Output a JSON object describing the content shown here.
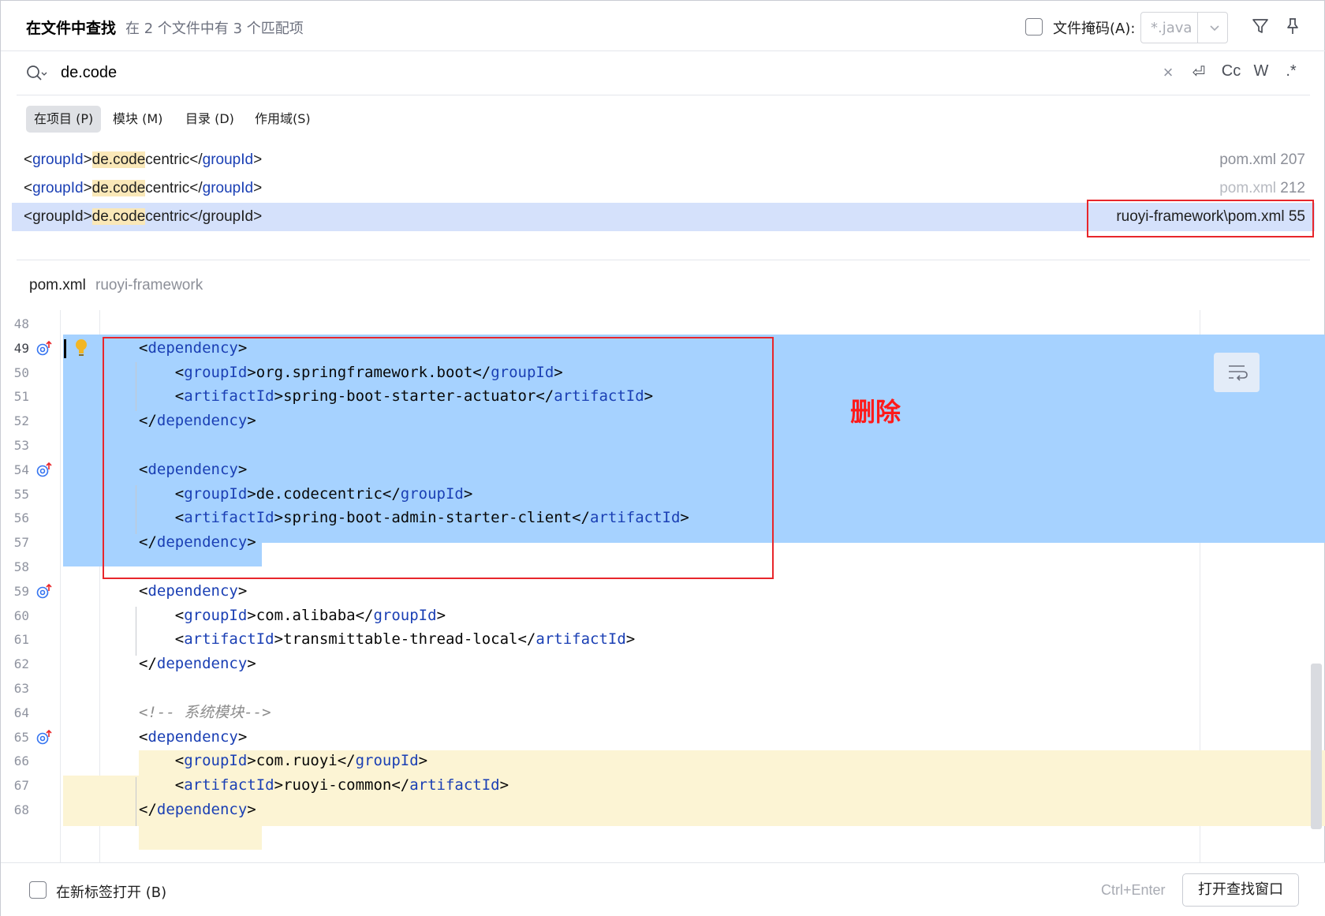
{
  "header": {
    "title": "在文件中查找",
    "subtitle": "在 2 个文件中有 3 个匹配项",
    "file_mask_label": "文件掩码(A):",
    "file_mask_value": "*.java",
    "file_mask_checked": false,
    "icons": [
      "filter-icon",
      "pin-icon"
    ]
  },
  "search": {
    "query": "de.code",
    "icons": [
      "clear-icon",
      "newline-icon",
      "match-case-icon",
      "words-icon",
      "regex-icon"
    ],
    "clear_glyph": "×",
    "newline_glyph": "⏎",
    "match_case_label": "Cc",
    "words_label": "W",
    "regex_label": ".*"
  },
  "scopes": [
    {
      "label": "在项目 (P)",
      "active": true
    },
    {
      "label": "模块 (M)",
      "active": false
    },
    {
      "label": "目录 (D)",
      "active": false
    },
    {
      "label": "作用域(S)",
      "active": false
    }
  ],
  "results": [
    {
      "open": "<",
      "tag": "groupId",
      "close_open": ">",
      "match": "de.code",
      "rest": "centric",
      "end_open": "</",
      "end_tag": "groupId",
      "end_close": ">",
      "location_dim": "",
      "location": "pom.xml 207",
      "selected": false
    },
    {
      "open": "<",
      "tag": "groupId",
      "close_open": ">",
      "match": "de.code",
      "rest": "centric",
      "end_open": "</",
      "end_tag": "groupId",
      "end_close": ">",
      "location_dim": "pom.xml",
      "location": " 212",
      "selected": false
    },
    {
      "open": "<",
      "tag": "groupId",
      "close_open": ">",
      "match": "de.code",
      "rest": "centric",
      "end_open": "</",
      "end_tag": "groupId",
      "end_close": ">",
      "location_dim": "",
      "location": "ruoyi-framework\\pom.xml 55",
      "selected": true
    }
  ],
  "preview": {
    "file": "pom.xml",
    "path": "ruoyi-framework"
  },
  "editor_lines": [
    {
      "n": "48",
      "text": ""
    },
    {
      "n": "49",
      "text": "<dependency>"
    },
    {
      "n": "50",
      "text": "    <groupId>org.springframework.boot</groupId>"
    },
    {
      "n": "51",
      "text": "    <artifactId>spring-boot-starter-actuator</artifactId>"
    },
    {
      "n": "52",
      "text": "</dependency>"
    },
    {
      "n": "53",
      "text": ""
    },
    {
      "n": "54",
      "text": "<dependency>"
    },
    {
      "n": "55",
      "text": "    <groupId>de.codecentric</groupId>"
    },
    {
      "n": "56",
      "text": "    <artifactId>spring-boot-admin-starter-client</artifactId>"
    },
    {
      "n": "57",
      "text": "</dependency>"
    },
    {
      "n": "58",
      "text": ""
    },
    {
      "n": "59",
      "text": "<dependency>"
    },
    {
      "n": "60",
      "text": "    <groupId>com.alibaba</groupId>"
    },
    {
      "n": "61",
      "text": "    <artifactId>transmittable-thread-local</artifactId>"
    },
    {
      "n": "62",
      "text": "</dependency>"
    },
    {
      "n": "63",
      "text": ""
    },
    {
      "n": "64",
      "text": "<!-- 系统模块-->"
    },
    {
      "n": "65",
      "text": "<dependency>"
    },
    {
      "n": "66",
      "text": "    <groupId>com.ruoyi</groupId>"
    },
    {
      "n": "67",
      "text": "    <artifactId>ruoyi-common</artifactId>"
    },
    {
      "n": "68",
      "text": "</dependency>"
    }
  ],
  "annotation": "删除",
  "footer": {
    "open_in_new_tab_label": "在新标签打开 (B)",
    "open_in_new_tab_checked": false,
    "shortcut": "Ctrl+Enter",
    "open_window_button": "打开查找窗口"
  },
  "colors": {
    "selection": "#a6d2ff",
    "usage_highlight": "#fcf4d4",
    "search_highlight": "#fae8b8",
    "xml_tag": "#1a3fb4",
    "annotation_red": "#ff1a1a"
  }
}
